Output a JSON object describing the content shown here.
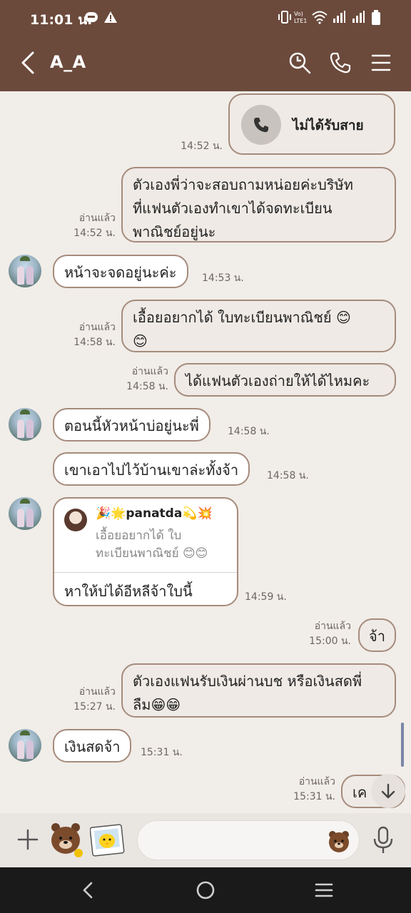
{
  "status": {
    "time": "11:01 น."
  },
  "header": {
    "title": "A_A"
  },
  "missed_call": {
    "label": "ไม่ได้รับสาย",
    "time": "14:52 น."
  },
  "messages": [
    {
      "line1": "ตัวเองพี่ว่าจะสอบถามหน่อยค่ะบริษัท",
      "line2": "ที่แฟนตัวเองทำเขาได้จดทะเบียน",
      "line3": "พาณิชย์อยู่นะ",
      "read": "อ่านแล้ว",
      "time": "14:52 น."
    },
    {
      "text": "หน้าจะจดอยู่นะค่ะ",
      "time": "14:53 น."
    },
    {
      "line1": "เอื้อยอยากได้ ใบทะเบียนพาณิชย์ 😊",
      "line2": "😊",
      "read": "อ่านแล้ว",
      "time": "14:58 น."
    },
    {
      "text": "ได้แฟนตัวเองถ่ายให้ได้ไหมคะ",
      "read": "อ่านแล้ว",
      "time": "14:58 น."
    },
    {
      "text": "ตอนนี้หัวหน้าบ่อยู่นะพี่",
      "time": "14:58 น."
    },
    {
      "text": "เขาเอาไปไว้บ้านเขาล่ะทั้งจ้า",
      "time": "14:58 น."
    },
    {
      "reply_name": "🎉🌟panatda💫💥",
      "reply_quote1": "เอื้อยอยากได้ ใบ",
      "reply_quote2": "ทะเบียนพาณิชย์ 😊😊",
      "text": "หาให้บ่ได้อีหลีจ้าใบนี้",
      "time": "14:59 น."
    },
    {
      "text": "จ้า",
      "read": "อ่านแล้ว",
      "time": "15:00 น."
    },
    {
      "line1": "ตัวเองแฟนรับเงินผ่านบช หรือเงินสดพี่",
      "line2": "ลืม😁😁",
      "read": "อ่านแล้ว",
      "time": "15:27 น."
    },
    {
      "text": "เงินสดจ้า",
      "time": "15:31 น."
    },
    {
      "text": "เค",
      "read": "อ่านแล้ว",
      "time": "15:31 น."
    }
  ],
  "colors": {
    "header": "#6b4a3c",
    "background": "#f1ede8",
    "bubble_border": "#a58b7c"
  }
}
